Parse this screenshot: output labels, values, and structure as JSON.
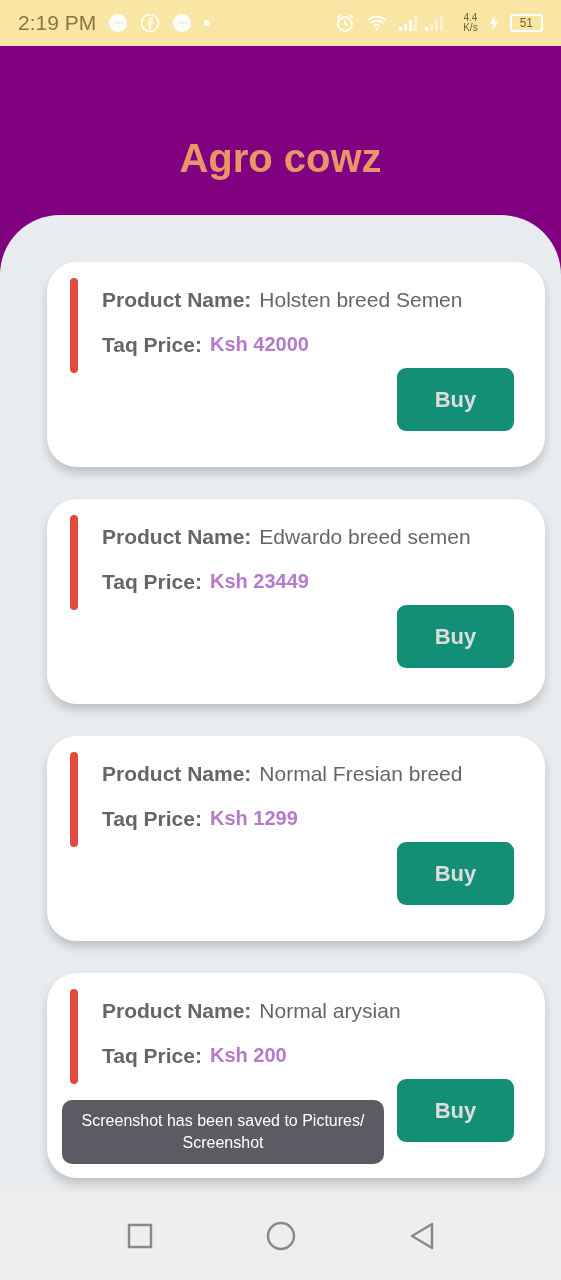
{
  "status_bar": {
    "time": "2:19 PM",
    "net_speed": "4.4",
    "net_unit": "K/s",
    "battery": "51"
  },
  "header": {
    "title": "Agro cowz"
  },
  "products": [
    {
      "name_label": "Product Name:",
      "name": "Holsten breed Semen",
      "price_label": "Taq Price:",
      "price": "Ksh 42000",
      "button": "Buy"
    },
    {
      "name_label": "Product Name:",
      "name": "Edwardo breed semen",
      "price_label": "Taq Price:",
      "price": "Ksh 23449",
      "button": "Buy"
    },
    {
      "name_label": "Product Name:",
      "name": "Normal Fresian breed",
      "price_label": "Taq Price:",
      "price": "Ksh 1299",
      "button": "Buy"
    },
    {
      "name_label": "Product Name:",
      "name": "Normal arysian",
      "price_label": "Taq Price:",
      "price": "Ksh 200",
      "button": "Buy"
    }
  ],
  "toast": {
    "text": "Screenshot has been saved to  Pictures/ Screenshot"
  }
}
